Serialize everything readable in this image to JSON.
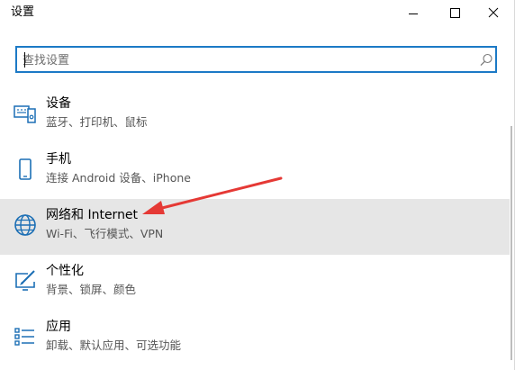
{
  "window": {
    "title": "设置"
  },
  "search": {
    "placeholder": "查找设置",
    "value": ""
  },
  "items": [
    {
      "title": "设备",
      "subtitle": "蓝牙、打印机、鼠标",
      "icon": "devices-icon"
    },
    {
      "title": "手机",
      "subtitle": "连接 Android 设备、iPhone",
      "icon": "phone-icon"
    },
    {
      "title": "网络和 Internet",
      "subtitle": "Wi-Fi、飞行模式、VPN",
      "icon": "globe-icon",
      "selected": true
    },
    {
      "title": "个性化",
      "subtitle": "背景、锁屏、颜色",
      "icon": "personalization-icon"
    },
    {
      "title": "应用",
      "subtitle": "卸载、默认应用、可选功能",
      "icon": "apps-icon"
    }
  ],
  "colors": {
    "accent": "#1c7ac6",
    "selected_bg": "#e6e6e6",
    "annotation_arrow": "#e53935"
  }
}
